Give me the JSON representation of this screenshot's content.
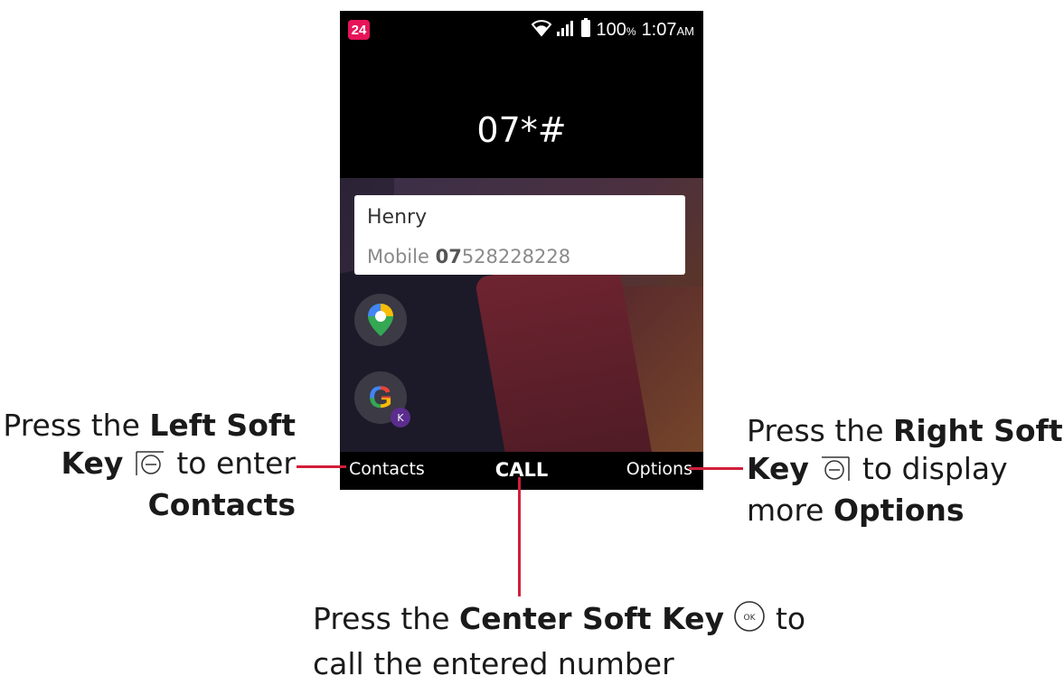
{
  "status_bar": {
    "notification_count": "24",
    "battery_value": "100",
    "battery_unit": "%",
    "time": "1:07",
    "ampm": "AM",
    "icons": [
      "wifi-icon",
      "signal-icon",
      "battery-icon"
    ]
  },
  "dialer": {
    "number": "07*#"
  },
  "suggestion": {
    "name": "Henry",
    "type": "Mobile",
    "number_match": "07",
    "number_rest": "528228228"
  },
  "softkeys": {
    "left": "Contacts",
    "center": "CALL",
    "right": "Options"
  },
  "home_icons": [
    "maps-icon",
    "google-icon"
  ],
  "callouts": {
    "left": {
      "press": "Press the",
      "key_name_1": "Left Soft",
      "key_name_2": "Key",
      "action": "to enter",
      "target": "Contacts"
    },
    "right": {
      "press": "Press the",
      "key_name_1": "Right Soft",
      "key_name_2": "Key",
      "action": "to display",
      "more": "more",
      "target": "Options"
    },
    "center": {
      "press": "Press the",
      "key_name": "Center Soft Key",
      "to": "to",
      "action": "call the entered number",
      "ok_glyph": "OK"
    }
  },
  "colors": {
    "accent_red": "#d11f3a",
    "notification_pink": "#e8145a"
  }
}
